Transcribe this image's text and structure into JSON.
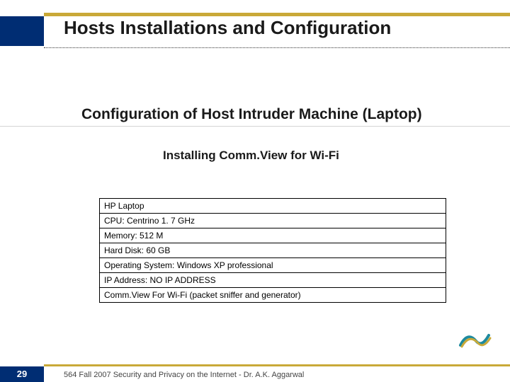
{
  "title": "Hosts Installations and Configuration",
  "subtitle": "Configuration of Host Intruder Machine (Laptop)",
  "section": "Installing Comm.View for Wi-Fi",
  "specs": [
    "HP Laptop",
    "CPU: Centrino 1. 7 GHz",
    "Memory: 512 M",
    "Hard Disk: 60 GB",
    "Operating System: Windows XP professional",
    "IP Address: NO IP ADDRESS",
    "Comm.View For Wi-Fi (packet sniffer and generator)"
  ],
  "page_number": "29",
  "footer": "564 Fall 2007 Security and Privacy on the Internet - Dr. A.K. Aggarwal"
}
